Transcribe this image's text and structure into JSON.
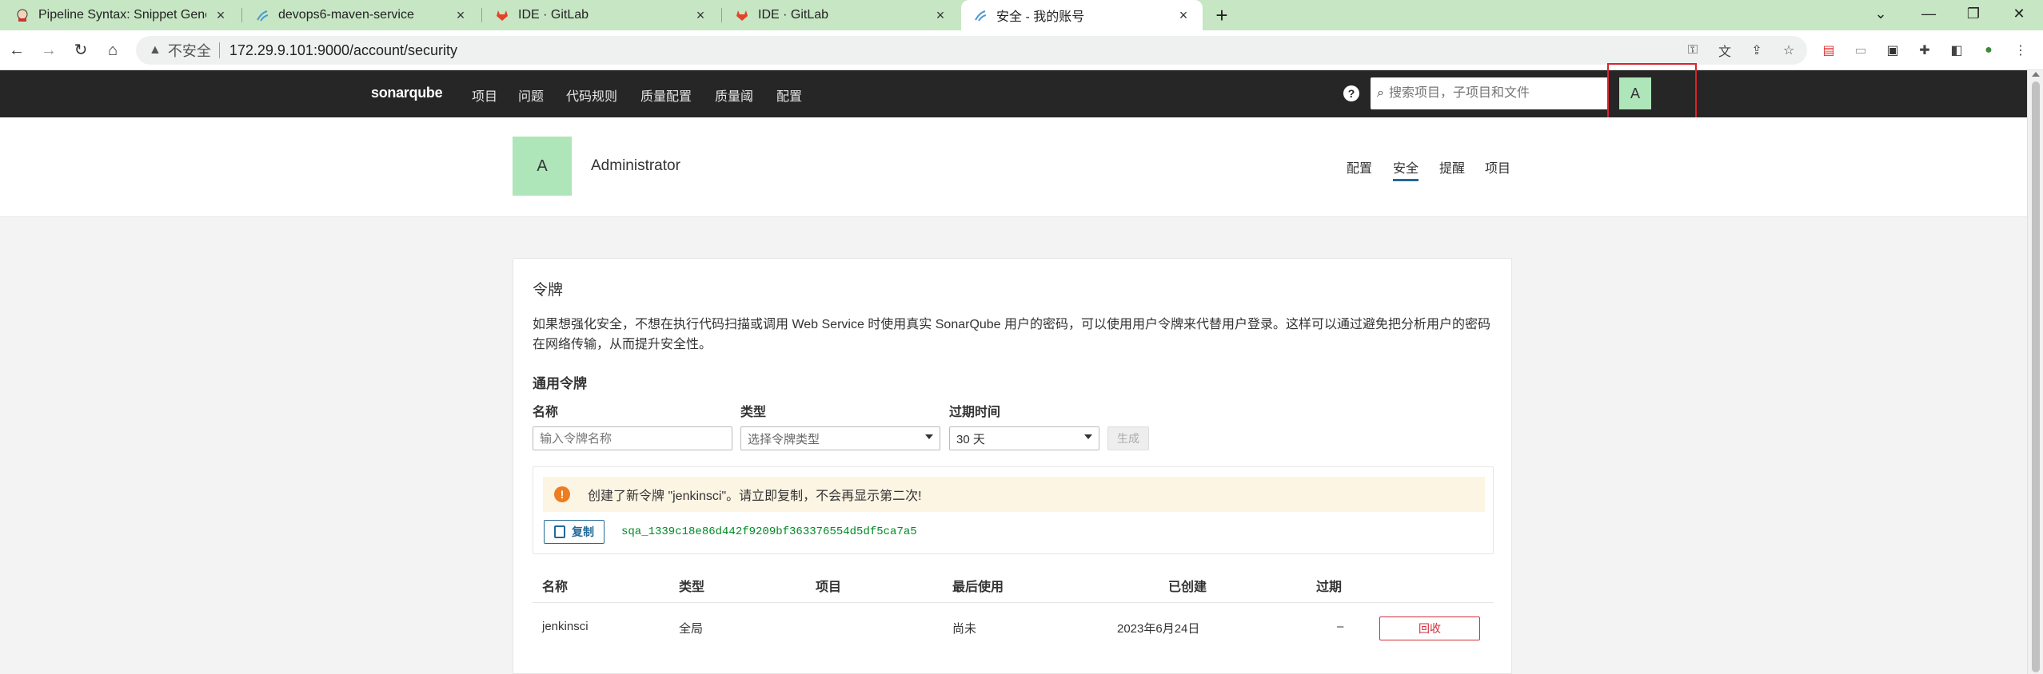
{
  "browser": {
    "tabs": [
      {
        "title": "Pipeline Syntax: Snippet Gener",
        "icon": "jenkins-icon"
      },
      {
        "title": "devops6-maven-service",
        "icon": "sonarqube-icon"
      },
      {
        "title": "IDE · GitLab",
        "icon": "gitlab-icon"
      },
      {
        "title": "IDE · GitLab",
        "icon": "gitlab-icon"
      },
      {
        "title": "安全 - 我的账号",
        "icon": "sonarqube-icon"
      }
    ],
    "address": {
      "insecure_label": "不安全",
      "url": "172.29.9.101:9000/account/security"
    }
  },
  "nav": {
    "logo": "sonarqube",
    "items": [
      "项目",
      "问题",
      "代码规则",
      "质量配置",
      "质量阈",
      "配置"
    ],
    "search_placeholder": "搜索项目，子项目和文件",
    "avatar_letter": "A"
  },
  "account": {
    "avatar_letter": "A",
    "name": "Administrator",
    "tabs": [
      "配置",
      "安全",
      "提醒",
      "项目"
    ],
    "active_tab": "安全"
  },
  "tokens": {
    "title": "令牌",
    "description": "如果想强化安全，不想在执行代码扫描或调用 Web Service 时使用真实 SonarQube 用户的密码，可以使用用户令牌来代替用户登录。这样可以通过避免把分析用户的密码在网络传输，从而提升安全性。",
    "section_title": "通用令牌",
    "form": {
      "name_label": "名称",
      "name_placeholder": "输入令牌名称",
      "type_label": "类型",
      "type_placeholder": "选择令牌类型",
      "expiry_label": "过期时间",
      "expiry_value": "30 天",
      "generate_label": "生成"
    },
    "alert": "创建了新令牌 \"jenkinsci\"。请立即复制，不会再显示第二次!",
    "copy_label": "复制",
    "token_value": "sqa_1339c18e86d442f9209bf363376554d5df5ca7a5",
    "table": {
      "headers": [
        "名称",
        "类型",
        "项目",
        "最后使用",
        "已创建",
        "过期"
      ],
      "rows": [
        {
          "name": "jenkinsci",
          "type": "全局",
          "project": "",
          "last_used": "尚未",
          "created": "2023年6月24日",
          "expiry": "–",
          "action": "回收"
        }
      ]
    }
  },
  "colors": {
    "nav_bg": "#262626",
    "avatar_bg": "#aee6b9",
    "accent_blue": "#236a97",
    "token_green": "#008a25",
    "revoke_red": "#d02f3a",
    "alert_bg": "#fcf5e4",
    "alert_icon": "#ed7d20",
    "highlight_red": "#d9232e"
  }
}
